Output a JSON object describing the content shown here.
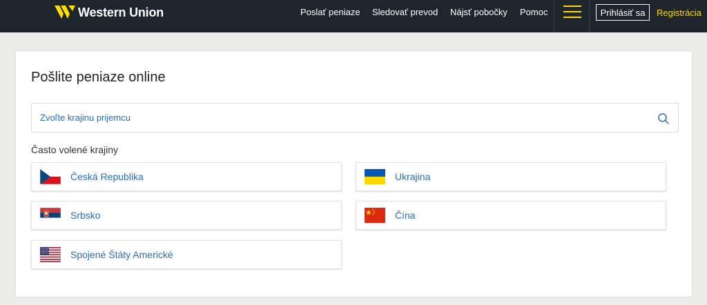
{
  "header": {
    "brand": "Western Union",
    "nav": [
      {
        "label": "Poslať peniaze"
      },
      {
        "label": "Sledovať prevod"
      },
      {
        "label": "Nájsť pobočky"
      },
      {
        "label": "Pomoc"
      }
    ],
    "login_label": "Prihlásiť sa",
    "register_label": "Registrácia",
    "colors": {
      "bar": "#1e252c",
      "accent": "#ffdd00"
    }
  },
  "main": {
    "title": "Pošlite peniaze online",
    "search": {
      "placeholder": "Zvoľte krajinu prijemcu",
      "value": "",
      "icon": "search-icon"
    },
    "popular_label": "Často volené krajiny",
    "countries": [
      {
        "name": "Česká Republika",
        "flag": "czech-flag-icon"
      },
      {
        "name": "Ukrajina",
        "flag": "ukraine-flag-icon"
      },
      {
        "name": "Srbsko",
        "flag": "serbia-flag-icon"
      },
      {
        "name": "Čína",
        "flag": "china-flag-icon"
      },
      {
        "name": "Spojené Štáty Americké",
        "flag": "usa-flag-icon"
      }
    ],
    "colors": {
      "link": "#2a6db5"
    }
  }
}
